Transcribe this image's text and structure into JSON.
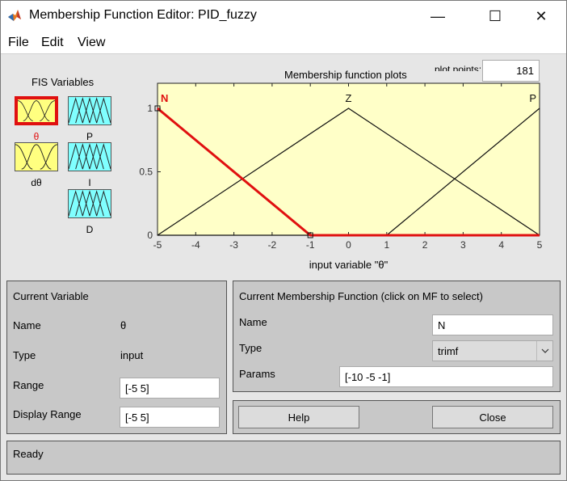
{
  "window": {
    "title": "Membership Function Editor: PID_fuzzy",
    "minimize_glyph": "—",
    "maximize_glyph": "☐",
    "close_glyph": "✕"
  },
  "menu": {
    "file": "File",
    "edit": "Edit",
    "view": "View"
  },
  "fis_variables": {
    "title": "FIS Variables",
    "inputs": [
      {
        "label": "θ",
        "selected": true,
        "color": "#ffff80"
      },
      {
        "label": "dθ",
        "selected": false,
        "color": "#ffff80"
      }
    ],
    "outputs": [
      {
        "label": "P",
        "color": "#80ffff"
      },
      {
        "label": "I",
        "color": "#80ffff"
      },
      {
        "label": "D",
        "color": "#80ffff"
      }
    ]
  },
  "plot": {
    "title": "Membership function plots",
    "plot_points_label": "plot points:",
    "plot_points_value": "181",
    "xlabel": "input variable \"θ\"",
    "background": "#ffffc8",
    "selected_color": "#e01010"
  },
  "chart_data": {
    "type": "line",
    "title": "Membership function plots",
    "xlabel": "input variable \"θ\"",
    "ylabel": "",
    "xlim": [
      -5,
      5
    ],
    "ylim": [
      0,
      1
    ],
    "x_ticks": [
      "-5",
      "-4",
      "-3",
      "-2",
      "-1",
      "0",
      "1",
      "2",
      "3",
      "4",
      "5"
    ],
    "y_ticks": [
      "0",
      "0.5",
      "1"
    ],
    "series": [
      {
        "name": "N",
        "points": [
          [
            -5,
            1
          ],
          [
            -1,
            0
          ],
          [
            5,
            0
          ]
        ],
        "selected": true
      },
      {
        "name": "Z",
        "points": [
          [
            -5,
            0
          ],
          [
            0,
            1
          ],
          [
            5,
            0
          ]
        ],
        "selected": false
      },
      {
        "name": "P",
        "points": [
          [
            -5,
            0
          ],
          [
            1,
            0
          ],
          [
            5,
            1
          ]
        ],
        "selected": false
      }
    ]
  },
  "current_variable": {
    "title": "Current Variable",
    "name_label": "Name",
    "name_value": "θ",
    "type_label": "Type",
    "type_value": "input",
    "range_label": "Range",
    "range_value": "[-5 5]",
    "display_range_label": "Display Range",
    "display_range_value": "[-5 5]"
  },
  "current_mf": {
    "title": "Current Membership Function (click on MF to select)",
    "name_label": "Name",
    "name_value": "N",
    "type_label": "Type",
    "type_value": "trimf",
    "params_label": "Params",
    "params_value": "[-10 -5 -1]"
  },
  "buttons": {
    "help": "Help",
    "close": "Close"
  },
  "status": {
    "text": "Ready"
  }
}
